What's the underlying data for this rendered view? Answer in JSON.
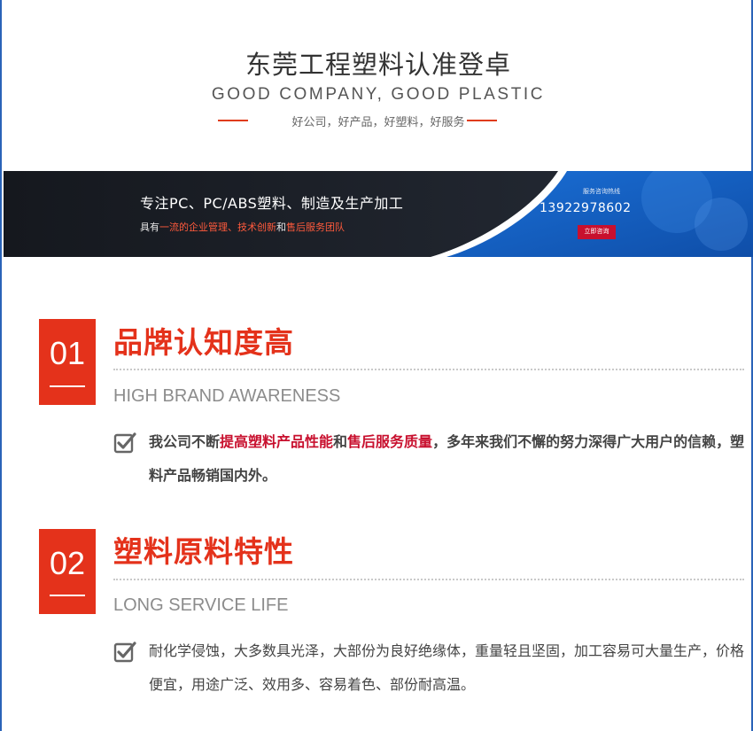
{
  "header": {
    "title": "东莞工程塑料认准登卓",
    "subtitle": "GOOD COMPANY, GOOD PLASTIC",
    "tagline": "好公司，好产品，好塑料，好服务"
  },
  "banner": {
    "main_text": "专注PC、PC/ABS塑料、制造及生产加工",
    "line2_prefix": "具有",
    "line2_hl1": "一流的企业管理、技术创新",
    "line2_mid": "和",
    "line2_hl2": "售后服务团队",
    "hotline_label": "服务咨询热线",
    "hotline_number": "13922978602",
    "consult_button": "立即咨询"
  },
  "sections": [
    {
      "number": "01",
      "title": "品牌认知度高",
      "subtitle_en": "HIGH BRAND AWARENESS",
      "desc_prefix": "我公司不断",
      "desc_hl1": "提高塑料产品性能",
      "desc_mid": "和",
      "desc_hl2": "售后服务质量",
      "desc_suffix": "，多年来我们不懈的努力深得广大用户的信赖，塑料产品畅销国内外。"
    },
    {
      "number": "02",
      "title": "塑料原料特性",
      "subtitle_en": "LONG SERVICE LIFE",
      "description": "耐化学侵蚀，大多数具光泽，大部份为良好绝缘体，重量轻且坚固，加工容易可大量生产，价格便宜，用途广泛、效用多、容易着色、部份耐高温。"
    }
  ],
  "colors": {
    "accent_red": "#e4321b",
    "highlight_red": "#c8102e",
    "frame_blue": "#2a63b8",
    "banner_dark": "#1b1f27",
    "banner_blue": "#1763c6"
  }
}
